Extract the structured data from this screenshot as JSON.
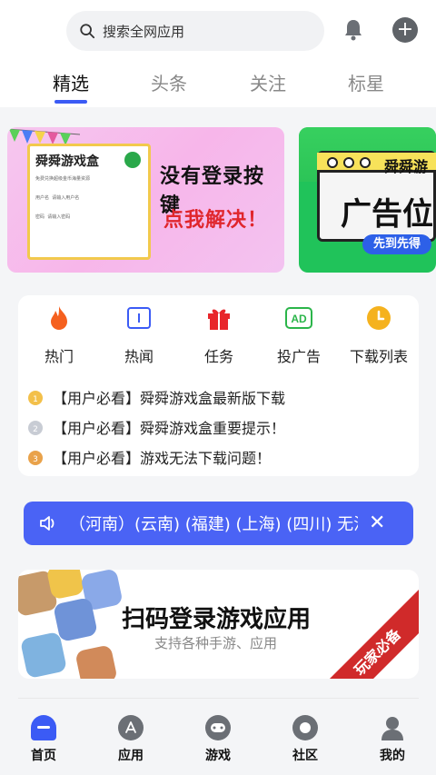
{
  "search": {
    "placeholder": "搜索全网应用"
  },
  "tabs": [
    {
      "label": "精选",
      "active": true
    },
    {
      "label": "头条",
      "active": false
    },
    {
      "label": "关注",
      "active": false
    },
    {
      "label": "标星",
      "active": false
    }
  ],
  "banners": [
    {
      "card_title": "舜舜游戏盒",
      "card_subtitle": "免费兑换超级金币海量资源",
      "card_field_user": "用户名",
      "card_field_user_hint": "请输入用户名",
      "card_field_pass": "密码",
      "card_field_pass_hint": "请输入密码",
      "line1": "没有登录按键",
      "line2": "点我解决！"
    },
    {
      "title": "舜舜游",
      "big": "广告位",
      "pill": "先到先得"
    }
  ],
  "quick_actions": [
    {
      "label": "热门",
      "icon": "flame-icon"
    },
    {
      "label": "热闻",
      "icon": "book-icon"
    },
    {
      "label": "任务",
      "icon": "gift-icon"
    },
    {
      "label": "投广告",
      "icon": "ad-icon"
    },
    {
      "label": "下载列表",
      "icon": "clock-icon"
    }
  ],
  "notices": [
    {
      "text": "【用户必看】舜舜游戏盒最新版下载",
      "medal": "1"
    },
    {
      "text": "【用户必看】舜舜游戏盒重要提示！",
      "medal": "2"
    },
    {
      "text": "【用户必看】游戏无法下载问题！",
      "medal": "3"
    }
  ],
  "marquee": {
    "text": "（河南）(云南) (福建) (上海) (四川) 无法加"
  },
  "scan_banner": {
    "title": "扫码登录游戏应用",
    "subtitle": "支持各种手游、应用",
    "ribbon": "玩家必备"
  },
  "bottom_nav": [
    {
      "label": "首页",
      "active": true
    },
    {
      "label": "应用",
      "active": false
    },
    {
      "label": "游戏",
      "active": false
    },
    {
      "label": "社区",
      "active": false
    },
    {
      "label": "我的",
      "active": false
    }
  ],
  "colors": {
    "accent": "#3b5bf5",
    "marquee_bg": "#4a63f5",
    "flame": "#f5601e",
    "gift": "#e8262b",
    "ad": "#2bb54a",
    "clock": "#f5b21e",
    "ribbon": "#d02a2a"
  }
}
